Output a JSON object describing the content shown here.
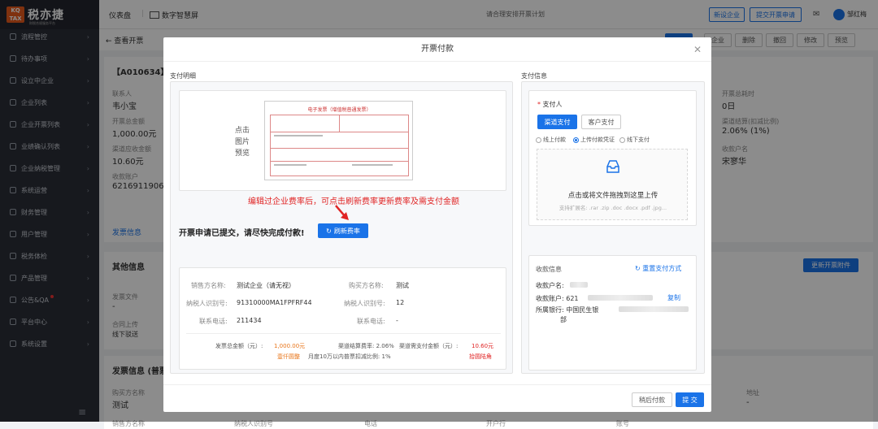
{
  "logo": {
    "badge": "KQ TAX",
    "name": "税亦捷",
    "sub": "财税合规服务平台"
  },
  "sidebar": {
    "items": [
      {
        "label": "流程管控"
      },
      {
        "label": "待办事项"
      },
      {
        "label": "设立中企业"
      },
      {
        "label": "企业列表"
      },
      {
        "label": "企业开票列表"
      },
      {
        "label": "业绩确认列表"
      },
      {
        "label": "企业纳税管理"
      },
      {
        "label": "系统运营"
      },
      {
        "label": "财务管理"
      },
      {
        "label": "用户管理"
      },
      {
        "label": "税务体检"
      },
      {
        "label": "产品管理"
      },
      {
        "label": "公告&QA"
      },
      {
        "label": "平台中心"
      },
      {
        "label": "系统设置"
      }
    ],
    "collapse_icon": "≡"
  },
  "header": {
    "dashboard": "仪表盘",
    "smart_screen": "数字智慧屏",
    "notice": "请合理安排开票计划",
    "new_company": "新设企业",
    "submit_invoice": "提交开票申请",
    "user": "邹红梅"
  },
  "page": {
    "back": "← 查看开票",
    "actions": [
      "企业",
      "删除",
      "撤回",
      "修改",
      "预览"
    ],
    "order_id": "【A010634】",
    "contact_label": "联系人",
    "contact": "韦小宝",
    "total_label": "开票总金额",
    "total": "1,000.00元",
    "channel_fee_label": "渠道应收金额",
    "channel_fee": "10.60元",
    "account_label": "收款账户",
    "account": "621691190622",
    "duration_label": "开票总耗时",
    "duration": "0日",
    "rate_label": "渠道结算(扣减比例)",
    "rate": "2.06% (1%)",
    "payee_label": "收款户名",
    "payee": "宋寥华",
    "tab_invoice_info": "发票信息",
    "other_info": "其他信息",
    "update_attach": "更新开票附件",
    "invoice_file_label": "发票文件",
    "invoice_file": "-",
    "contract_label": "合同上传",
    "contract": "线下驳送",
    "invoice_info_type": "发票信息 (普票",
    "buyer_name_label": "购买方名称",
    "buyer_name": "测试",
    "addr_label": "地址",
    "addr": "-",
    "bottom_cols": [
      "销售方名称",
      "纳税人识别号",
      "电话",
      "开户行",
      "账号"
    ]
  },
  "modal": {
    "title": "开票付款",
    "section_payment_detail": "支付明细",
    "section_payment_info": "支付信息",
    "preview_text": [
      "点击",
      "图片",
      "预览"
    ],
    "invoice_title": "电子发票（增值税普通发票）",
    "red_note": "编辑过企业费率后，可点击刷新费率更新费率及需支付金额",
    "submitted_text": "开票申请已提交，请尽快完成付款!",
    "refresh_btn": "刷新费率",
    "seller_name_label": "销售方名称:",
    "seller_name": "测试企业（请无视）",
    "buyer_name_label": "购买方名称:",
    "buyer_name": "测试",
    "seller_tax_label": "纳税人识别号:",
    "seller_tax": "91310000MA1FPFRF44",
    "buyer_tax_label": "纳税人识别号:",
    "buyer_tax": "12",
    "seller_phone_label": "联系电话:",
    "seller_phone": "211434",
    "buyer_phone_label": "联系电话:",
    "buyer_phone": "-",
    "invoice_total_label": "发票总金额（元）:",
    "invoice_total": "1,000.00元",
    "invoice_total_cn": "壹仟圆整",
    "settle_rate_label": "渠道结算费率: 2.06%",
    "need_pay_label": "渠道需支付金额（元）:",
    "need_pay": "10.60元",
    "need_pay_cn": "拾圆陆角",
    "deduct_label": "月度10万以内普票扣减比例: 1%",
    "payer_label": "支付人",
    "payer_channel": "渠道支付",
    "payer_customer": "客户支付",
    "radio_offline": "线上付款",
    "radio_upload": "上传付款凭证",
    "radio_offline2": "线下支付",
    "upload_text": "点击或将文件拖拽到这里上传",
    "upload_ext": "支持扩展名: .rar .zip .doc .docx .pdf .jpg...",
    "receive_info": "收款信息",
    "reset_pay": "重置支付方式",
    "recv_name_label": "收款户名:",
    "recv_acc_label": "收款账户: 621",
    "copy": "复制",
    "bank_label": "所属银行: 中国民生银",
    "bank_tail": "部",
    "later_pay": "稍后付款",
    "submit": "提 交"
  },
  "colors": {
    "primary": "#1a73e8",
    "danger": "#e02424",
    "orange": "#e8751a"
  }
}
